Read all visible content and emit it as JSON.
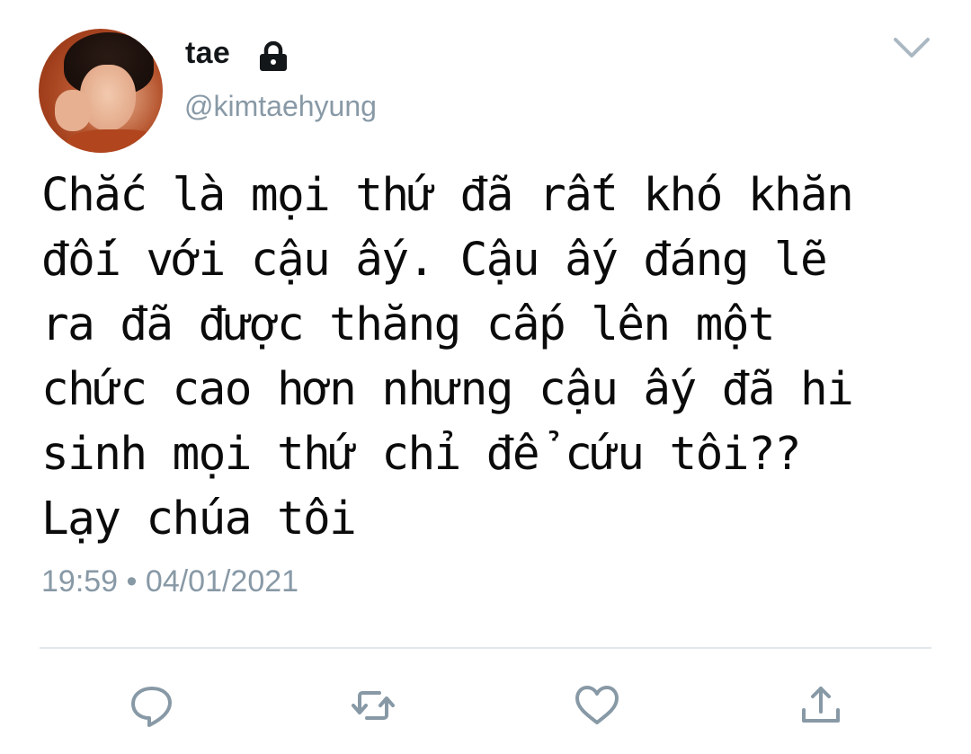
{
  "tweet": {
    "display_name": "tae",
    "handle": "@kimtaehyung",
    "text": "Chắc là mọi thứ đã rất khó khăn\nđối với cậu ấy. Cậu ấy đáng lẽ\nra đã được thăng cấp lên một\nchức cao hơn nhưng cậu ấy đã hi\nsinh mọi thứ chỉ để cứu tôi??\nLạy chúa tôi",
    "time": "19:59",
    "separator": "•",
    "date": "04/01/2021",
    "protected": true
  },
  "icons": {
    "lock": "lock-icon",
    "chevron": "chevron-down-icon",
    "reply": "reply-icon",
    "retweet": "retweet-icon",
    "like": "like-icon",
    "share": "share-icon"
  },
  "colors": {
    "text": "#0b0b0b",
    "secondary": "#8899a6",
    "divider": "#e1e8ed",
    "icon": "#8899a6"
  }
}
